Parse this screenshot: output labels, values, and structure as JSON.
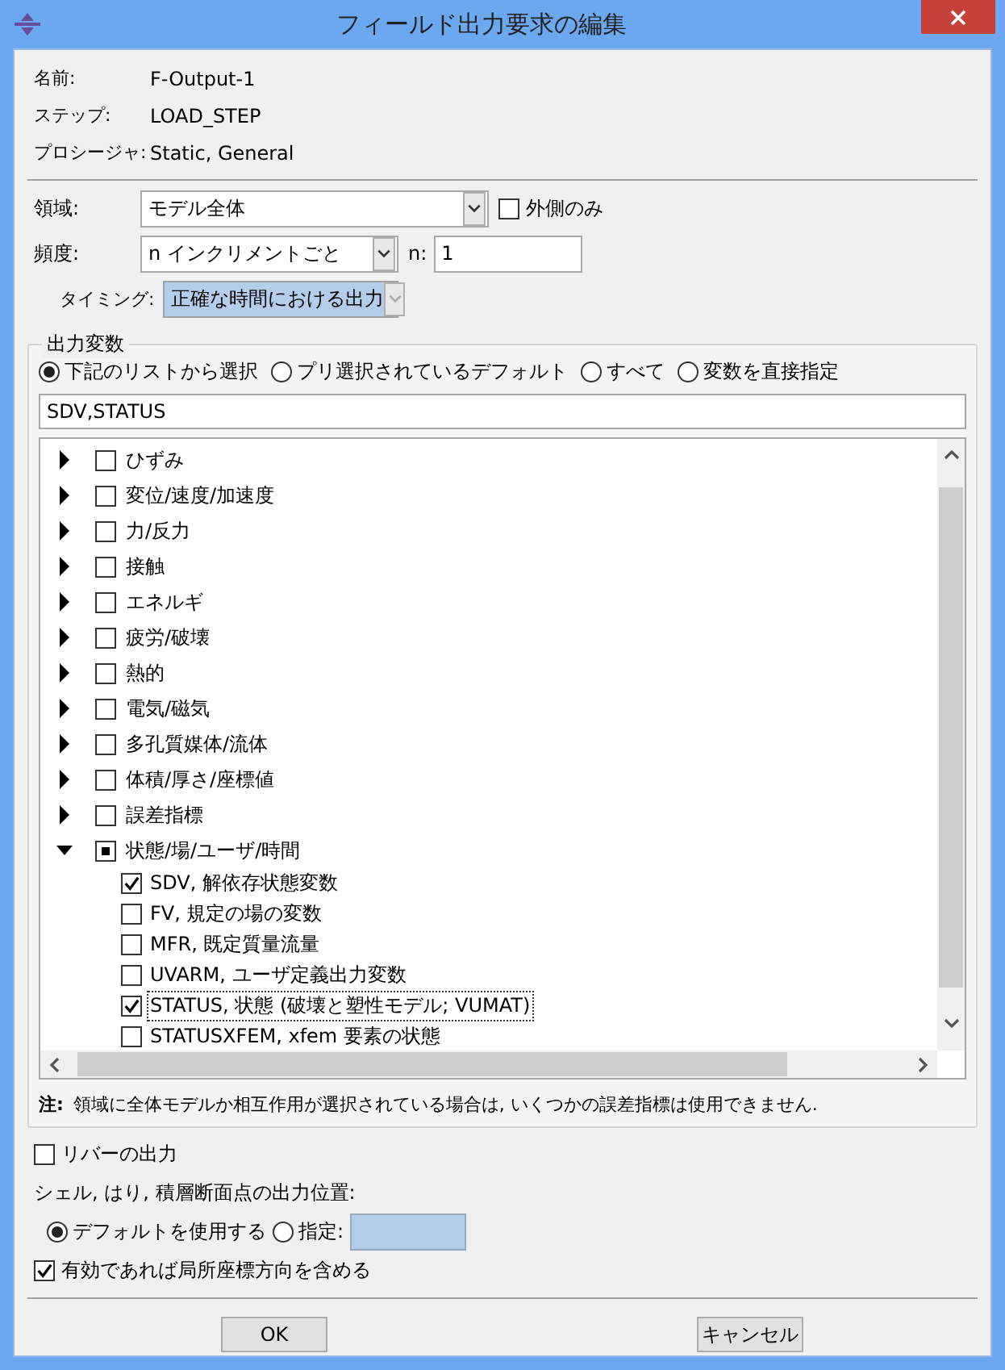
{
  "window": {
    "title": "フィールド出力要求の編集"
  },
  "info": [
    {
      "label": "名前:",
      "value": "F-Output-1"
    },
    {
      "label": "ステップ:",
      "value": "LOAD_STEP"
    },
    {
      "label": "プロシージャ:",
      "value": "Static, General"
    }
  ],
  "domain": {
    "label": "領域:",
    "value": "モデル全体",
    "exterior": {
      "label": "外側のみ",
      "checked": false
    }
  },
  "frequency": {
    "label": "頻度:",
    "value": "n インクリメントごと",
    "n_label": "n:",
    "n_value": "1"
  },
  "timing": {
    "label": "タイミング:",
    "value": "正確な時間における出力"
  },
  "output_variables": {
    "title": "出力変数",
    "options": [
      {
        "label": "下記のリストから選択",
        "selected": true
      },
      {
        "label": "プリ選択されているデフォルト",
        "selected": false
      },
      {
        "label": "すべて",
        "selected": false
      },
      {
        "label": "変数を直接指定",
        "selected": false
      }
    ],
    "value": "SDV,STATUS",
    "tree": [
      {
        "label": "ひずみ",
        "expanded": false,
        "checked": false,
        "partial": false
      },
      {
        "label": "変位/速度/加速度",
        "expanded": false,
        "checked": false,
        "partial": false
      },
      {
        "label": "力/反力",
        "expanded": false,
        "checked": false,
        "partial": false
      },
      {
        "label": "接触",
        "expanded": false,
        "checked": false,
        "partial": false
      },
      {
        "label": "エネルギ",
        "expanded": false,
        "checked": false,
        "partial": false
      },
      {
        "label": "疲労/破壊",
        "expanded": false,
        "checked": false,
        "partial": false
      },
      {
        "label": "熱的",
        "expanded": false,
        "checked": false,
        "partial": false
      },
      {
        "label": "電気/磁気",
        "expanded": false,
        "checked": false,
        "partial": false
      },
      {
        "label": "多孔質媒体/流体",
        "expanded": false,
        "checked": false,
        "partial": false
      },
      {
        "label": "体積/厚さ/座標値",
        "expanded": false,
        "checked": false,
        "partial": false
      },
      {
        "label": "誤差指標",
        "expanded": false,
        "checked": false,
        "partial": false
      },
      {
        "label": "状態/場/ユーザ/時間",
        "expanded": true,
        "checked": false,
        "partial": true,
        "children": [
          {
            "label": "SDV, 解依存状態変数",
            "checked": true,
            "focused": false
          },
          {
            "label": "FV, 規定の場の変数",
            "checked": false,
            "focused": false
          },
          {
            "label": "MFR, 既定質量流量",
            "checked": false,
            "focused": false
          },
          {
            "label": "UVARM, ユーザ定義出力変数",
            "checked": false,
            "focused": false
          },
          {
            "label": "STATUS, 状態 (破壊と塑性モデル; VUMAT)",
            "checked": true,
            "focused": true
          },
          {
            "label": "STATUSXFEM, xfem 要素の状態",
            "checked": false,
            "focused": false
          }
        ]
      }
    ],
    "note_label": "注:",
    "note": "領域に全体モデルか相互作用が選択されている場合は, いくつかの誤差指標は使用できません."
  },
  "rebar": {
    "label": "リバーの出力",
    "checked": false
  },
  "section_points": {
    "label": "シェル, はり, 積層断面点の出力位置:",
    "options": [
      {
        "label": "デフォルトを使用する",
        "selected": true
      },
      {
        "label": "指定:",
        "selected": false
      }
    ]
  },
  "local_csys": {
    "label": "有効であれば局所座標方向を含める",
    "checked": true
  },
  "buttons": [
    "OK",
    "キャンセル"
  ]
}
